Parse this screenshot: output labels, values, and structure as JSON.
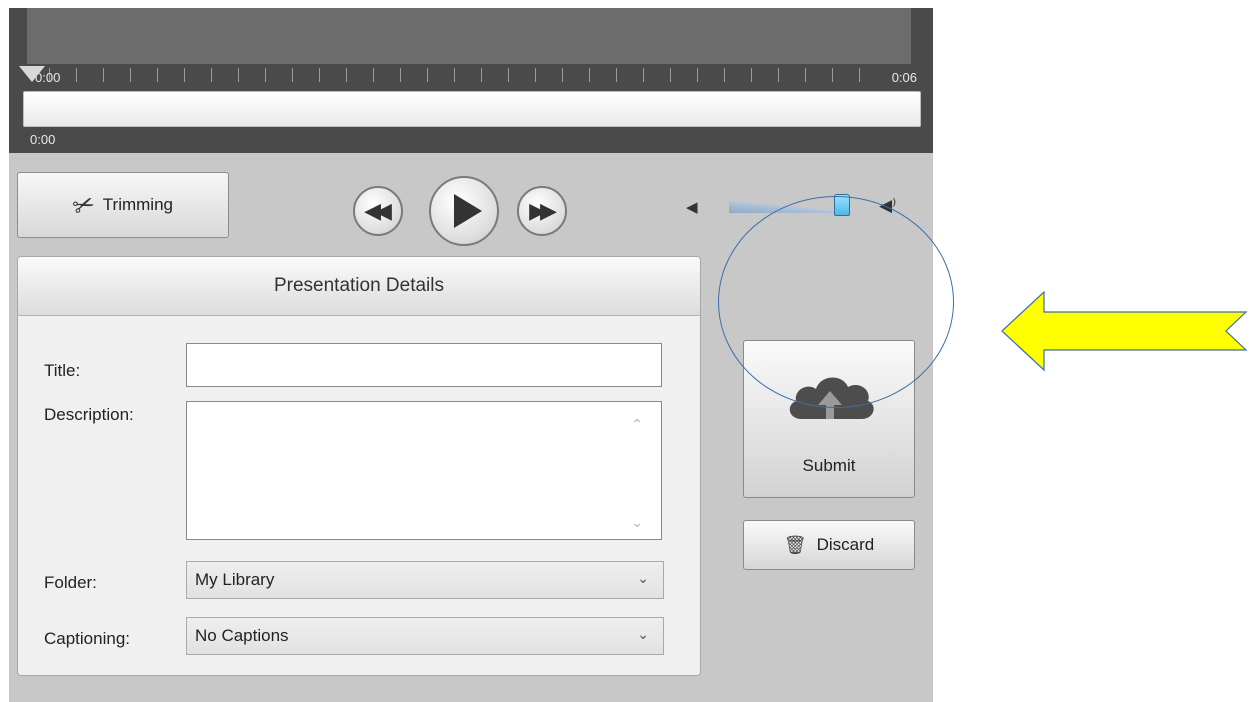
{
  "timeline": {
    "ruler_start": "0:00",
    "ruler_end": "0:06",
    "current_time": "0:00"
  },
  "controls": {
    "trimming_label": "Trimming",
    "rewind_icon": "rewind-icon",
    "play_icon": "play-icon",
    "fast_forward_icon": "fast-forward-icon",
    "volume_level": 0.87
  },
  "panel": {
    "title": "Presentation Details",
    "title_label": "Title:",
    "title_value": "",
    "description_label": "Description:",
    "description_value": "",
    "folder_label": "Folder:",
    "folder_value": "My Library",
    "captioning_label": "Captioning:",
    "captioning_value": "No Captions"
  },
  "actions": {
    "submit_label": "Submit",
    "discard_label": "Discard"
  },
  "colors": {
    "annotation_arrow": "#ffff00",
    "annotation_circle": "#3b6fa8"
  }
}
